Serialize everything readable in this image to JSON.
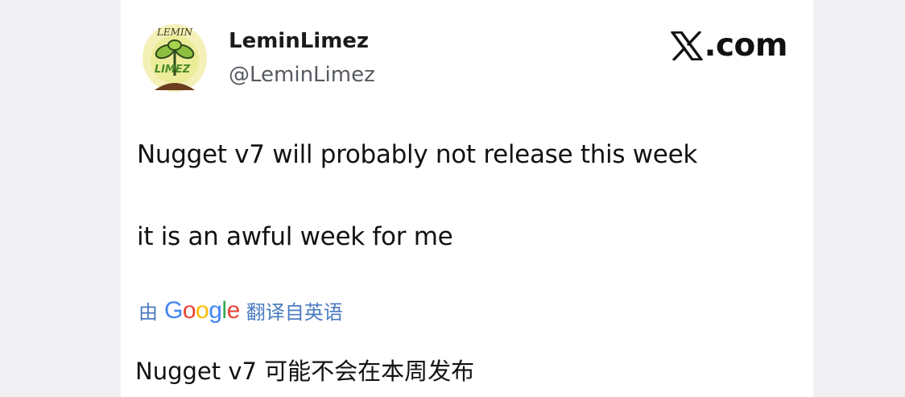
{
  "account": {
    "display_name": "LeminLimez",
    "handle": "@LeminLimez",
    "avatar_text_top": "LEMIN",
    "avatar_text_bottom": "LIMEZ"
  },
  "source": {
    "brand": "com",
    "brand_icon": "x-logo-icon"
  },
  "tweet": {
    "line1": "Nugget v7 will probably not release this week",
    "line2": "it is an awful week for me"
  },
  "translation": {
    "by_label": "由",
    "provider": [
      "G",
      "o",
      "o",
      "g",
      "l",
      "e"
    ],
    "from_label": "翻译自英语",
    "text": "Nugget v7 可能不会在本周发布"
  },
  "colors": {
    "link_blue": "#4a7bc0",
    "google": [
      "#4285F4",
      "#EA4335",
      "#FBBC05",
      "#4285F4",
      "#34A853",
      "#EA4335"
    ]
  }
}
